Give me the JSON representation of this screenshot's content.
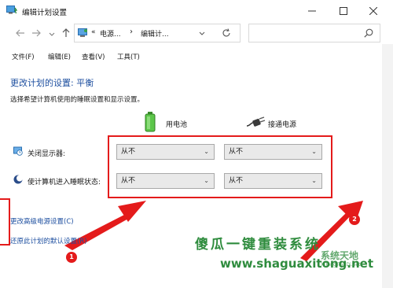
{
  "window": {
    "title": "编辑计划设置",
    "icon": "power-options-icon"
  },
  "controls": {
    "minimize": "minimize-icon",
    "maximize": "maximize-icon",
    "close": "close-icon"
  },
  "nav": {
    "breadcrumb_prefix": "«",
    "crumb1": "电源...",
    "separator": "›",
    "crumb2": "编辑计...",
    "dropdown": "chevron-down-icon",
    "refresh": "refresh-icon",
    "search_placeholder": "",
    "search_icon": "search-icon"
  },
  "menu": {
    "file": "文件(F)",
    "edit": "编辑(E)",
    "view": "查看(V)",
    "tools": "工具(T)"
  },
  "content": {
    "heading": "更改计划的设置: 平衡",
    "subtext": "选择希望计算机使用的睡眠设置和显示设置。",
    "battery_header": "用电池",
    "plugged_header": "接通电源",
    "display_label": "关闭显示器:",
    "sleep_label": "使计算机进入睡眠状态:",
    "display_battery_value": "从不",
    "display_plugged_value": "从不",
    "sleep_battery_value": "从不",
    "sleep_plugged_value": "从不",
    "advanced_link": "更改高级电源设置(C)",
    "restore_link": "还原此计划的默认设置(R)"
  },
  "annotations": {
    "badge1": "1",
    "badge2": "2",
    "accent_color": "#e41b1b"
  },
  "watermark": {
    "cn_text": "傻瓜一键重装系统",
    "url": "www.shaguaxitong.net",
    "logo_text": "系统天地",
    "logo_sub": "XiTongTianDi.net",
    "color": "#2f8c3e"
  }
}
